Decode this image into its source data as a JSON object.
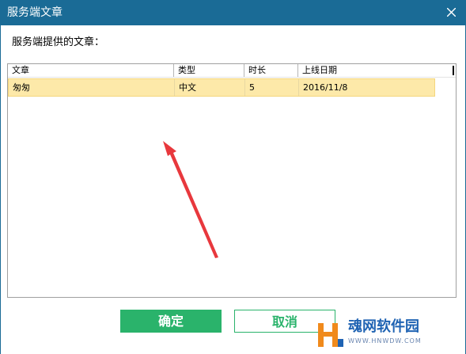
{
  "window": {
    "title": "服务端文章",
    "prompt": "服务端提供的文章："
  },
  "list": {
    "columns": [
      "文章",
      "类型",
      "时长",
      "上线日期"
    ],
    "rows": [
      [
        "匆匆",
        "中文",
        "5",
        "2016/11/8"
      ]
    ]
  },
  "buttons": {
    "ok": "确定",
    "cancel": "取消"
  },
  "watermark": {
    "text": "魂网软件园",
    "url": "WWW.HNWDW.COM"
  },
  "colors": {
    "titlebar": "#1a6b96",
    "accent": "#2ab36b",
    "selected_row": "#fde9a9",
    "arrow": "#e8383d"
  }
}
